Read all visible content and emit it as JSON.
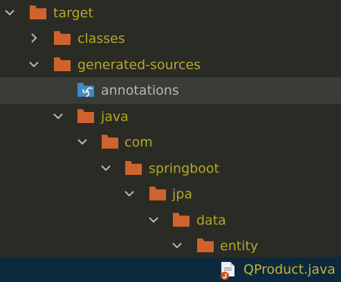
{
  "tree": {
    "nodes": [
      {
        "label": "target",
        "expanded": true,
        "icon": "folder-icon"
      },
      {
        "label": "classes",
        "expanded": false,
        "icon": "folder-icon"
      },
      {
        "label": "generated-sources",
        "expanded": true,
        "icon": "folder-icon"
      },
      {
        "label": "annotations",
        "icon": "generated-sources-root-folder-icon",
        "highlighted": true
      },
      {
        "label": "java",
        "expanded": true,
        "icon": "folder-icon"
      },
      {
        "label": "com",
        "expanded": true,
        "icon": "folder-icon"
      },
      {
        "label": "springboot",
        "expanded": true,
        "icon": "folder-icon"
      },
      {
        "label": "jpa",
        "expanded": true,
        "icon": "folder-icon"
      },
      {
        "label": "data",
        "expanded": true,
        "icon": "folder-icon"
      },
      {
        "label": "entity",
        "expanded": true,
        "icon": "folder-icon"
      },
      {
        "label": "QProduct.java",
        "icon": "java-file-icon",
        "selected": true
      }
    ]
  },
  "colors": {
    "background": "#2b2b25",
    "highlight_row": "#3a3c38",
    "selected_row": "#0d293e",
    "folder": "#d0632d",
    "folder_label": "#b3a82b",
    "plain_label": "#b8b8b0",
    "source_root_folder": "#3d8bc2",
    "arrow": "#bcbcbc"
  }
}
